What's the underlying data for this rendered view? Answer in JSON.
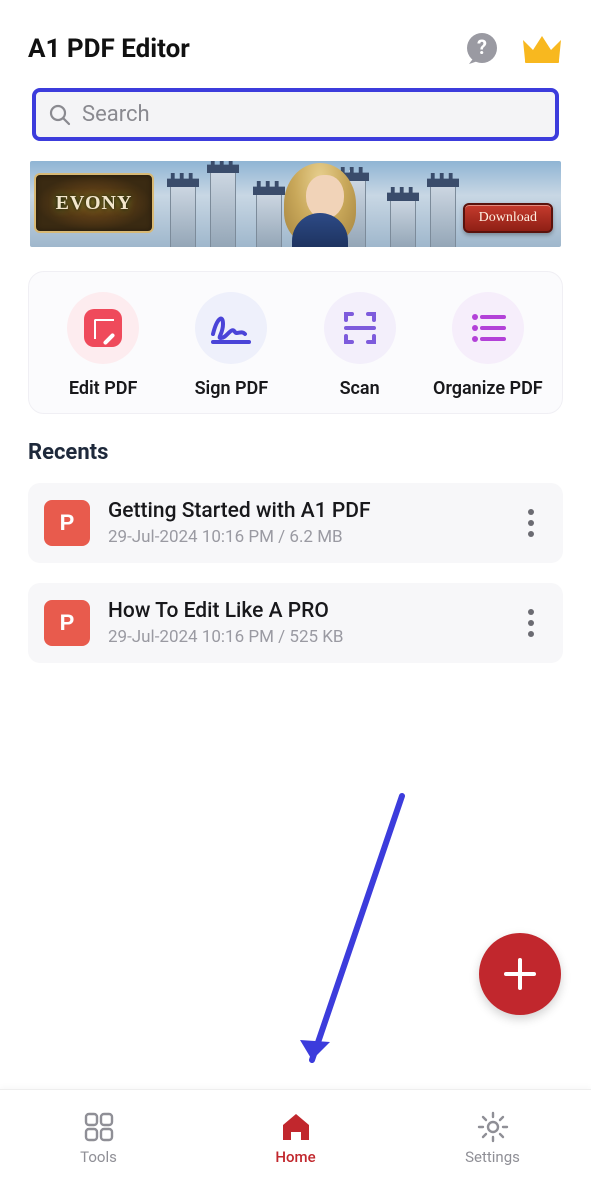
{
  "header": {
    "title": "A1 PDF Editor"
  },
  "search": {
    "placeholder": "Search"
  },
  "banner": {
    "logo": "EVONY",
    "cta": "Download"
  },
  "actions": {
    "edit": "Edit PDF",
    "sign": "Sign PDF",
    "scan": "Scan",
    "organize": "Organize PDF"
  },
  "recents": {
    "heading": "Recents",
    "items": [
      {
        "name": "Getting Started with A1 PDF",
        "meta": "29-Jul-2024 10:16 PM / 6.2 MB"
      },
      {
        "name": "How To Edit Like A PRO",
        "meta": "29-Jul-2024 10:16 PM / 525 KB"
      }
    ]
  },
  "nav": {
    "tools": "Tools",
    "home": "Home",
    "settings": "Settings"
  }
}
